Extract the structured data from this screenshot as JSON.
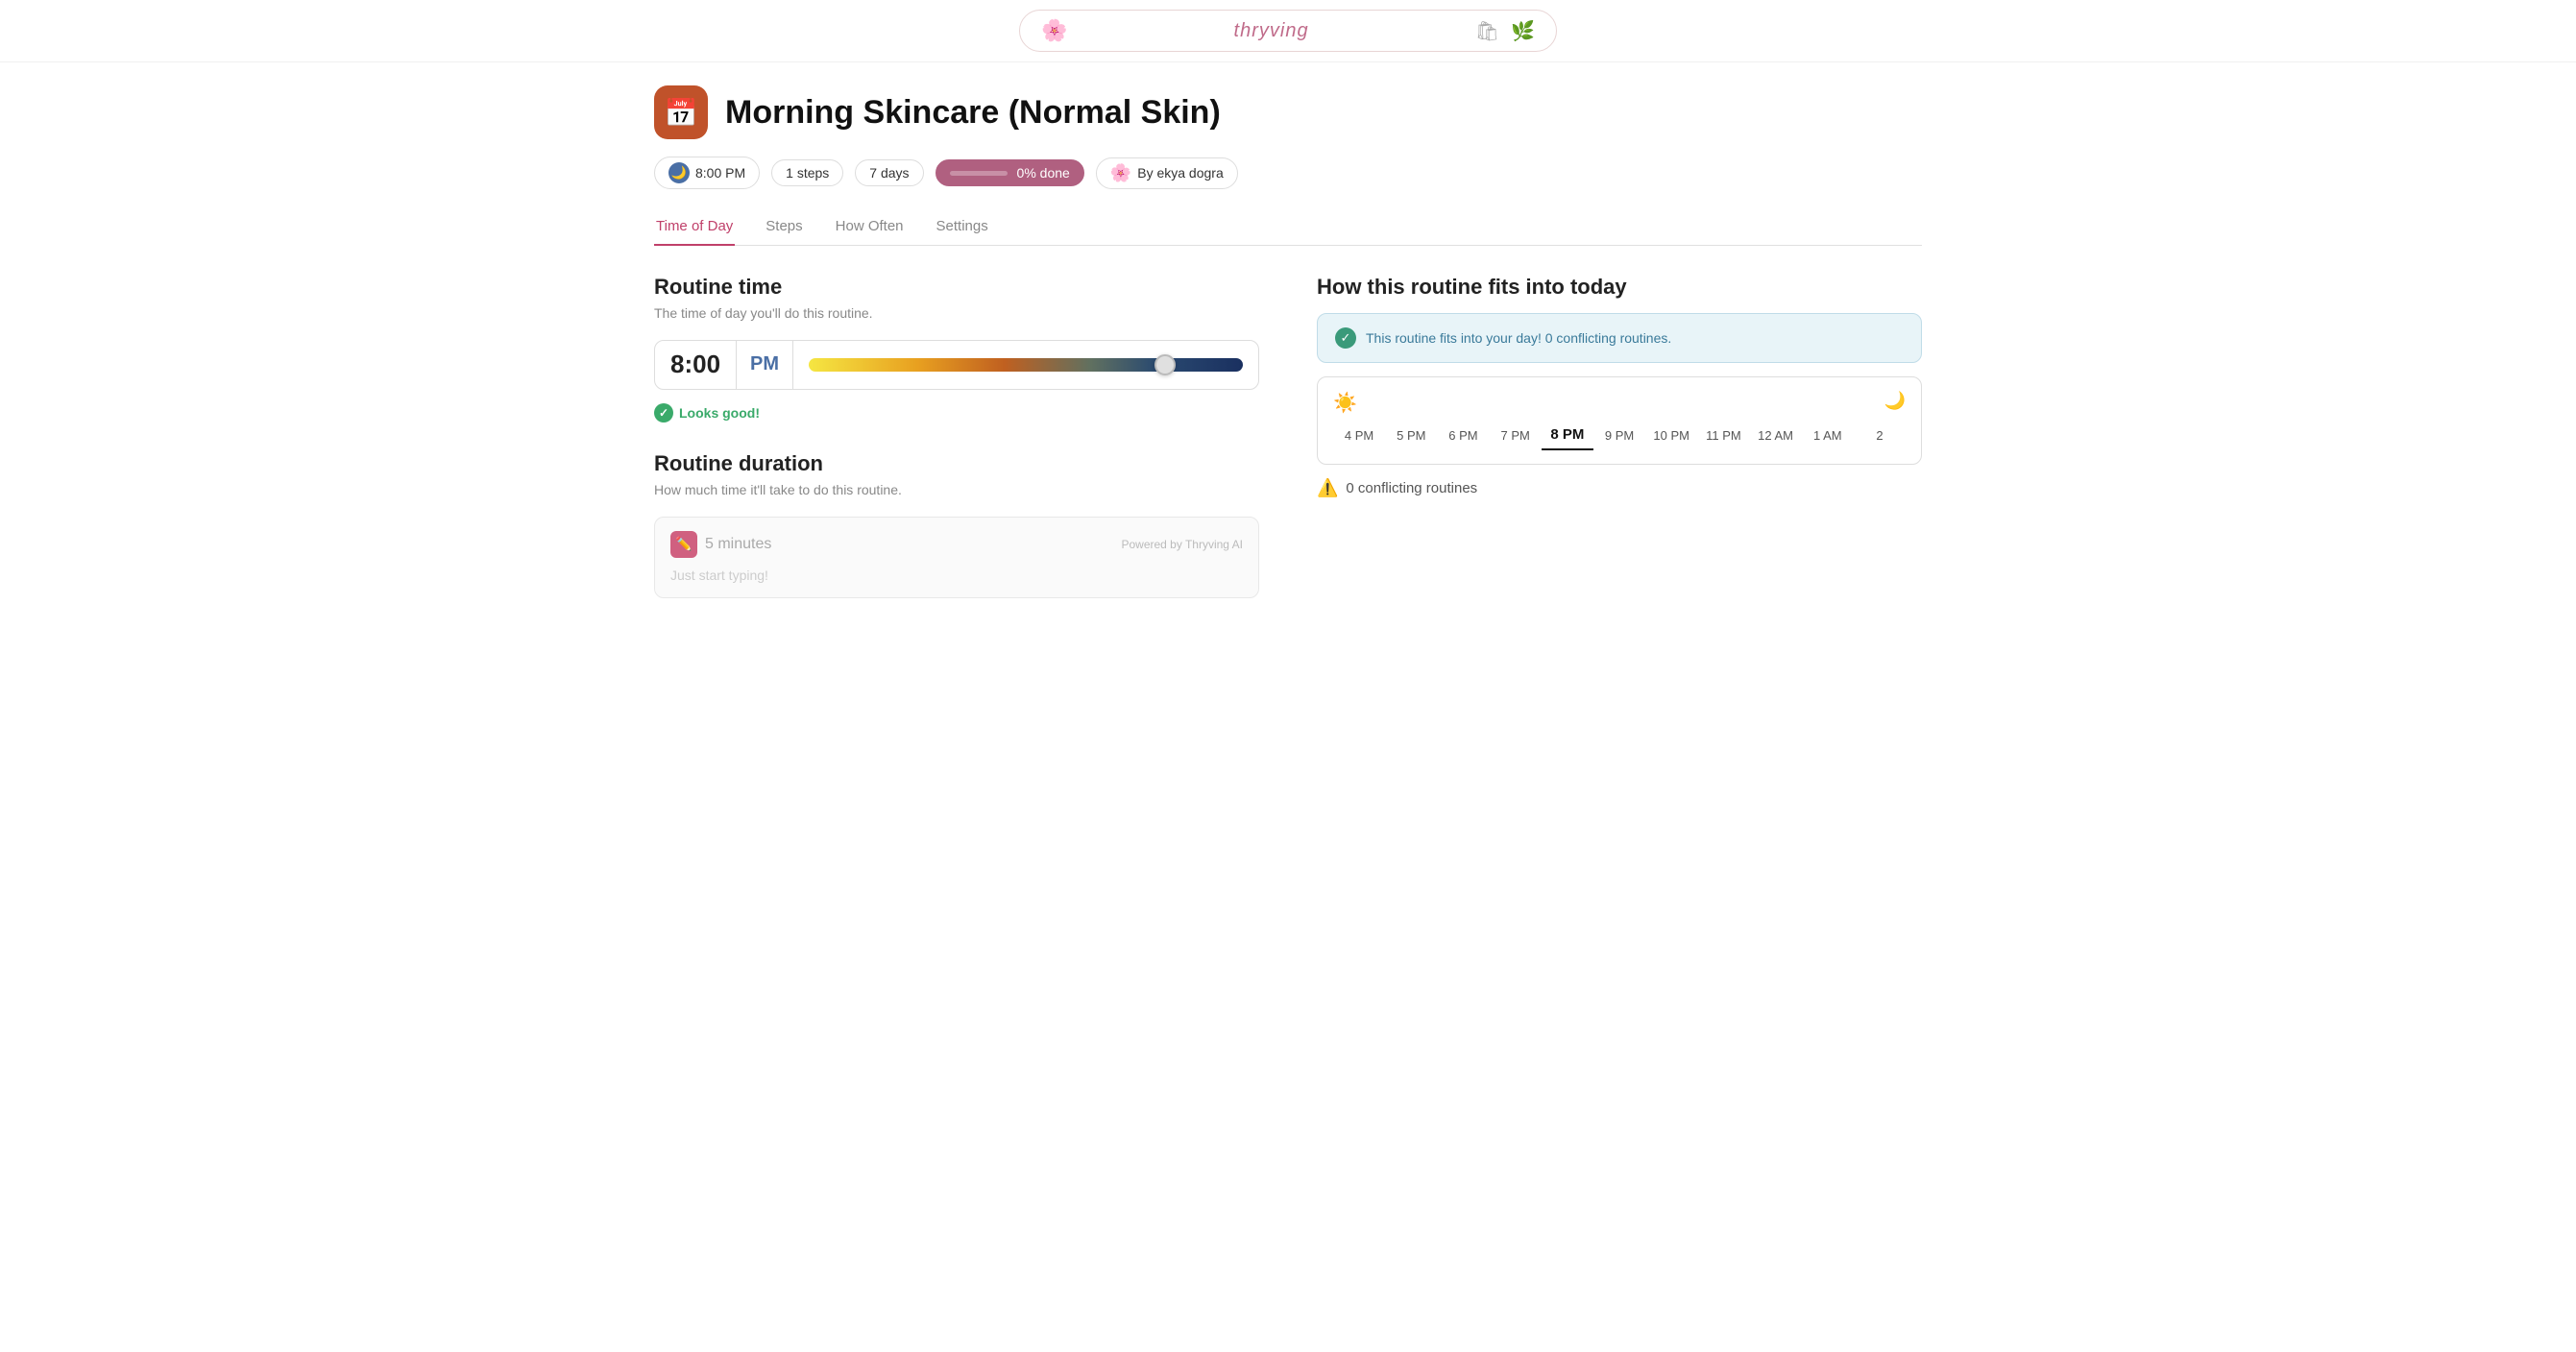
{
  "topNav": {
    "brandName": "thryving",
    "logoLeft": "🌸",
    "iconBag": "🛍",
    "iconLeaf": "🌿"
  },
  "pageHeader": {
    "iconEmoji": "📅",
    "title": "Morning Skincare (Normal Skin)"
  },
  "metaRow": {
    "time": "8:00 PM",
    "steps": "1 steps",
    "days": "7 days",
    "progressLabel": "0% done",
    "progressValue": 0,
    "authorLabel": "By ekya dogra"
  },
  "tabs": [
    {
      "label": "Time of Day",
      "active": true
    },
    {
      "label": "Steps",
      "active": false
    },
    {
      "label": "How Often",
      "active": false
    },
    {
      "label": "Settings",
      "active": false
    }
  ],
  "routineTime": {
    "sectionTitle": "Routine time",
    "sectionSubtitle": "The time of day you'll do this routine.",
    "timeHour": "8:00",
    "timeAmPm": "PM",
    "sliderPosition": 82,
    "looksGoodLabel": "Looks good!"
  },
  "routineDuration": {
    "sectionTitle": "Routine duration",
    "sectionSubtitle": "How much time it'll take to do this routine.",
    "durationValue": "5 minutes",
    "poweredBy": "Powered by Thryving AI",
    "inputPlaceholder": "Just start typing!"
  },
  "fitSection": {
    "title": "How this routine fits into today",
    "successMessage": "This routine fits into your day! 0 conflicting routines.",
    "hours": [
      "4 PM",
      "5 PM",
      "6 PM",
      "7 PM",
      "8 PM",
      "9 PM",
      "10 PM",
      "11 PM",
      "12 AM",
      "1 AM",
      "2"
    ],
    "activeHour": "8 PM",
    "conflictingCount": "0 conflicting routines"
  }
}
